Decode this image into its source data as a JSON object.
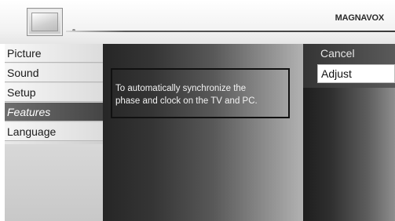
{
  "header": {
    "brand": "MAGNAVOX",
    "icon": "tv-icon"
  },
  "menu": {
    "items": [
      {
        "label": "Picture",
        "selected": false
      },
      {
        "label": "Sound",
        "selected": false
      },
      {
        "label": "Setup",
        "selected": false
      },
      {
        "label": "Features",
        "selected": true
      },
      {
        "label": "Language",
        "selected": false
      }
    ]
  },
  "info": {
    "line1": "To automatically synchronize the",
    "line2": "phase and clock on the TV and PC."
  },
  "options": {
    "cancel_label": "Cancel",
    "adjust_label": "Adjust"
  }
}
